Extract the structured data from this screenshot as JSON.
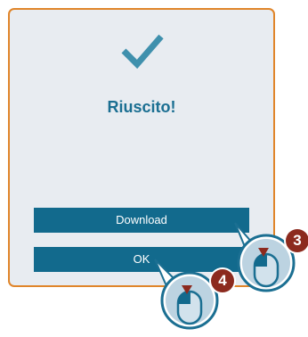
{
  "dialog": {
    "title": "Riuscito!",
    "download_label": "Download",
    "ok_label": "OK"
  },
  "callouts": [
    {
      "number": "3",
      "target": "Download"
    },
    {
      "number": "4",
      "target": "OK"
    }
  ],
  "colors": {
    "border": "#e0852a",
    "panel": "#e8ecf1",
    "accent": "#1b6f92",
    "button": "#126a8d",
    "badge": "#8c2a1e"
  },
  "icons": [
    "checkmark-icon",
    "mouse-left-click-icon"
  ]
}
